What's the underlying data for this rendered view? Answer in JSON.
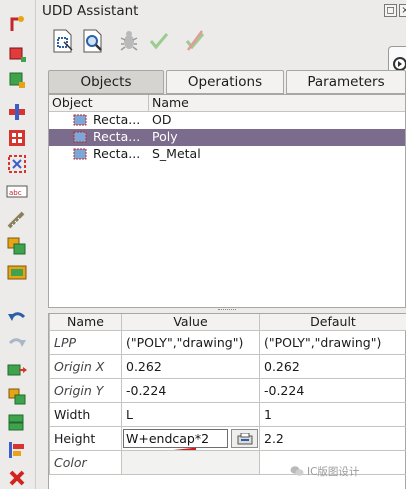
{
  "dock": {
    "title": "UDD Assistant",
    "float_glyph": "◻",
    "close_glyph": "×"
  },
  "toolbar": {
    "icons": [
      "select-objects-icon",
      "zoom-to-object-icon",
      "debug-bug-icon",
      "check-icon",
      "clear-check-icon"
    ],
    "run_glyph": "›"
  },
  "tabs": [
    {
      "label": "Objects",
      "active": true
    },
    {
      "label": "Operations",
      "active": false
    },
    {
      "label": "Parameters",
      "active": false
    }
  ],
  "object_list": {
    "headers": [
      "Object",
      "Name"
    ],
    "rows": [
      {
        "type": "Recta...",
        "name": "OD",
        "selected": false
      },
      {
        "type": "Recta...",
        "name": "Poly",
        "selected": true
      },
      {
        "type": "Recta...",
        "name": "S_Metal",
        "selected": false
      }
    ]
  },
  "property_table": {
    "headers": [
      "Name",
      "Value",
      "Default"
    ],
    "rows": [
      {
        "name": "LPP",
        "value": "(\"POLY\",\"drawing\")",
        "default": "(\"POLY\",\"drawing\")"
      },
      {
        "name": "Origin X",
        "value": "0.262",
        "default": "0.262"
      },
      {
        "name": "Origin Y",
        "value": "-0.224",
        "default": "-0.224"
      },
      {
        "name": "Width",
        "value": "L",
        "default": "1"
      },
      {
        "name": "Height",
        "value": "W+endcap*2",
        "default": "2.2"
      },
      {
        "name": "Color",
        "value": "",
        "default": ""
      }
    ]
  },
  "watermark": {
    "text": "IC版图设计"
  },
  "colors": {
    "selected_row": "#7b6b8c",
    "annotation_underline": "#d01818"
  }
}
